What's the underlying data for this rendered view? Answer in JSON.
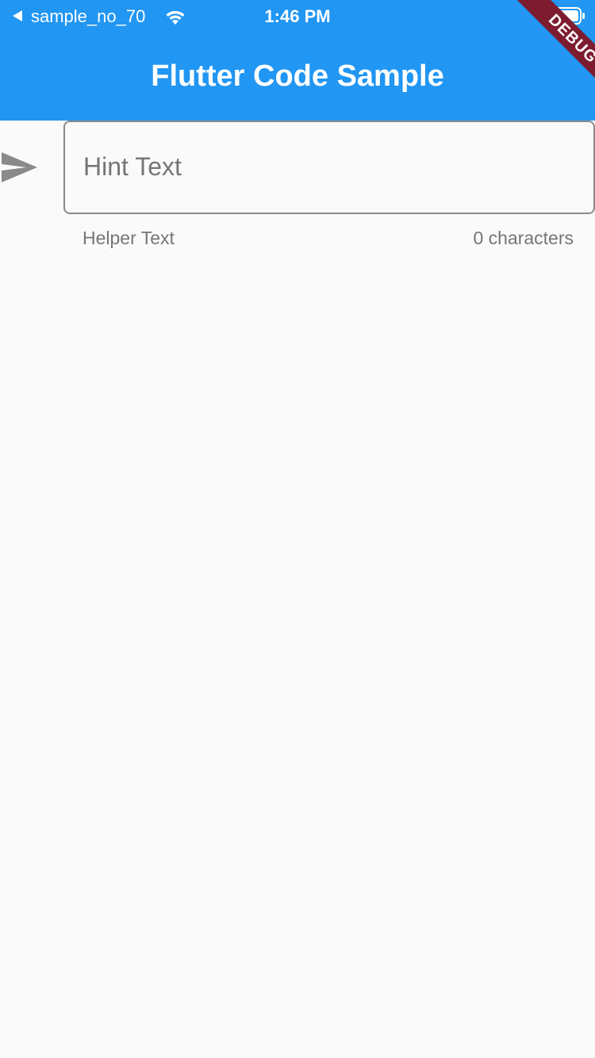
{
  "status_bar": {
    "back_icon": "back-triangle-icon",
    "carrier": "sample_no_70",
    "wifi_icon": "wifi-icon",
    "time": "1:46 PM",
    "battery_icon": "battery-icon"
  },
  "app_bar": {
    "title": "Flutter Code Sample",
    "background_color": "#2196f3"
  },
  "debug_banner": {
    "label": "DEBUG",
    "color": "#7d1c30"
  },
  "text_field": {
    "prefix_icon": "send-icon",
    "hint": "Hint Text",
    "value": "",
    "helper": "Helper Text",
    "counter": "0 characters"
  },
  "colors": {
    "page_background": "#fafafa",
    "hint_gray": "#757575",
    "border_gray": "#8a8a8a"
  }
}
